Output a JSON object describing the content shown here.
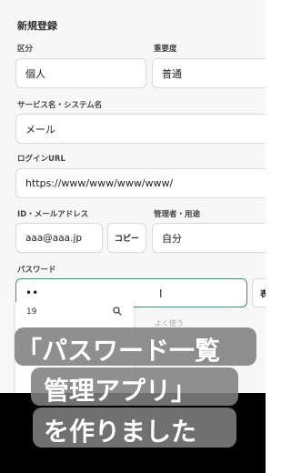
{
  "form": {
    "title": "新規登録",
    "category": {
      "label": "区分",
      "value": "個人"
    },
    "importance": {
      "label": "重要度",
      "value": "普通"
    },
    "service": {
      "label": "サービス名・システム名",
      "value": "メール"
    },
    "login_url": {
      "label": "ログインURL",
      "value": "https://www/www/www/www/"
    },
    "account": {
      "label": "ID・メールアドレス",
      "value": "aaa@aaa.jp",
      "copy_label": "コピー"
    },
    "manager": {
      "label": "管理者・用途",
      "value": "自分"
    },
    "password": {
      "label": "パスワード",
      "value": "••",
      "side_button_partial": "表"
    }
  },
  "dropdown": {
    "first_item": "19",
    "faint_header": "よく使う"
  },
  "caption": {
    "line1": "「パスワード一覧",
    "line2": "管理アプリ」",
    "line3": "を作りました"
  }
}
